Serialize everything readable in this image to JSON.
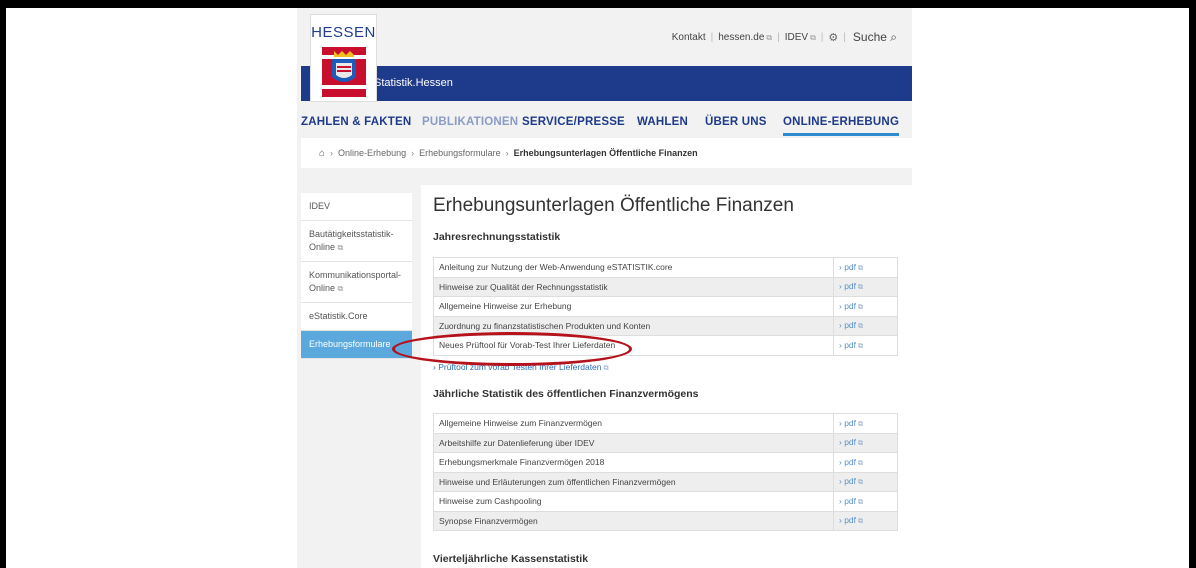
{
  "header": {
    "logo_text": "HESSEN",
    "brand": "Statistik.Hessen",
    "top_links": [
      {
        "label": "Kontakt"
      },
      {
        "label": "hessen.de"
      },
      {
        "label": "IDEV"
      }
    ],
    "search_label": "Suche"
  },
  "nav": {
    "items": [
      {
        "label": "ZAHLEN & FAKTEN"
      },
      {
        "label": "PUBLIKATIONEN"
      },
      {
        "label": "SERVICE/PRESSE"
      },
      {
        "label": "WAHLEN"
      },
      {
        "label": "ÜBER UNS"
      },
      {
        "label": "ONLINE-ERHEBUNG"
      }
    ],
    "active": "ONLINE-ERHEBUNG"
  },
  "breadcrumb": {
    "items": [
      "Online-Erhebung",
      "Erhebungsformulare"
    ],
    "current": "Erhebungsunterlagen Öffentliche Finanzen"
  },
  "sidebar": {
    "items": [
      {
        "label": "IDEV"
      },
      {
        "label": "Bautätigkeitsstatistik-Online"
      },
      {
        "label": "Kommunikationsportal-Online"
      },
      {
        "label": "eStatistik.Core"
      },
      {
        "label": "Erhebungsformulare"
      }
    ]
  },
  "content": {
    "title": "Erhebungsunterlagen Öffentliche Finanzen",
    "sections": [
      {
        "heading": "Jahresrechnungsstatistik",
        "rows": [
          "Anleitung zur Nutzung der Web-Anwendung eSTATISTIK.core",
          "Hinweise zur Qualität der Rechnungsstatistik",
          "Allgemeine Hinweise zur Erhebung",
          "Zuordnung zu finanzstatistischen Produkten und Konten",
          "Neues Prüftool für Vorab-Test Ihrer Lieferdaten"
        ]
      },
      {
        "heading": "Jährliche Statistik des öffentlichen Finanzvermögens",
        "rows": [
          "Allgemeine Hinweise zum Finanzvermögen",
          "Arbeitshilfe zur Datenlieferung über IDEV",
          "Erhebungsmerkmale Finanzvermögen 2018",
          "Hinweise und Erläuterungen zum öffentlichen Finanzvermögen",
          "Hinweise zum Cashpooling",
          "Synopse Finanzvermögen"
        ]
      },
      {
        "heading": "Vierteljährliche Kassenstatistik",
        "rows": []
      }
    ],
    "pdf_label": "› pdf",
    "tool_link": "› Prüftool zum vorab Testen Ihrer Lieferdaten"
  },
  "colors": {
    "brand_blue": "#1e3a8a",
    "link_blue": "#2e6db4",
    "highlight_ellipse": "#b5121b",
    "sidebar_active": "#5aa8dc"
  }
}
